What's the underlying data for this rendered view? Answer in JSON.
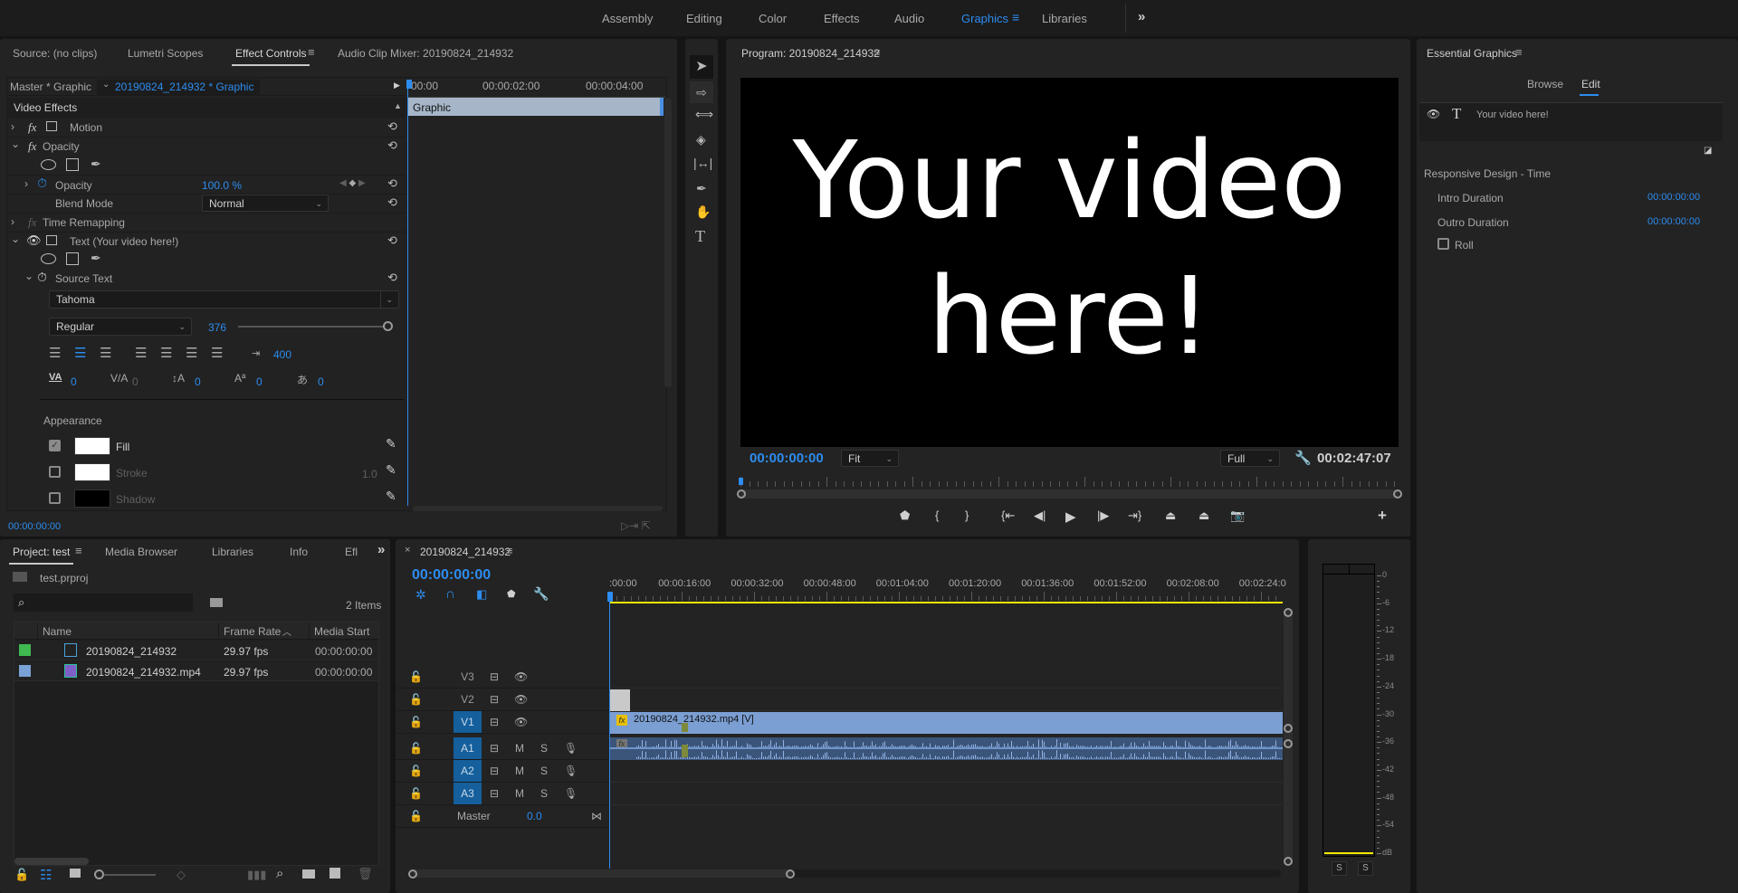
{
  "workspaces": {
    "items": [
      "Assembly",
      "Editing",
      "Color",
      "Effects",
      "Audio",
      "Graphics",
      "Libraries"
    ],
    "active": "Graphics",
    "more_icon": "chevron-double-right-icon"
  },
  "effect_controls": {
    "tabs": [
      "Source: (no clips)",
      "Lumetri Scopes",
      "Effect Controls",
      "Audio Clip Mixer: 20190824_214932"
    ],
    "active_tab": "Effect Controls",
    "master_label": "Master * Graphic",
    "clip_label": "20190824_214932 * Graphic",
    "section": "Video Effects",
    "motion": "Motion",
    "opacity": "Opacity",
    "opacity_prop": "Opacity",
    "opacity_value": "100.0 %",
    "blend_mode_label": "Blend Mode",
    "blend_mode": "Normal",
    "time_remapping": "Time Remapping",
    "text_layer": "Text (Your video here!)",
    "source_text": "Source Text",
    "font": "Tahoma",
    "font_style": "Regular",
    "font_size": "376",
    "font_size_fraction": 1.0,
    "tab_width": "400",
    "kerning": "0",
    "tracking": "0",
    "leading": "0",
    "baseline": "0",
    "tsume": "0",
    "appearance": "Appearance",
    "fill": {
      "label": "Fill",
      "checked": true,
      "color": "#ffffff"
    },
    "stroke": {
      "label": "Stroke",
      "checked": false,
      "color": "#ffffff",
      "width": "1.0"
    },
    "shadow": {
      "label": "Shadow",
      "checked": false,
      "color": "#000000"
    },
    "timecode": "00:00:00:00",
    "mini_timeline": {
      "ticks": [
        "00:00",
        "00:00:02:00",
        "00:00:04:00"
      ],
      "clip": "Graphic"
    }
  },
  "tools": [
    "selection-tool",
    "track-select-tool",
    "ripple-edit-tool",
    "razor-tool",
    "slip-tool",
    "pen-tool",
    "hand-tool",
    "type-tool"
  ],
  "program": {
    "title": "Program: 20190824_214932",
    "video_text_line1": "Your video",
    "video_text_line2": "here!",
    "timecode": "00:00:00:00",
    "zoom": "Fit",
    "resolution": "Full",
    "duration": "00:02:47:07"
  },
  "essential_graphics": {
    "title": "Essential Graphics",
    "tabs": [
      "Browse",
      "Edit"
    ],
    "active_tab": "Edit",
    "layer": "Your video here!",
    "section": "Responsive Design - Time",
    "intro_label": "Intro Duration",
    "intro_value": "00:00:00:00",
    "outro_label": "Outro Duration",
    "outro_value": "00:00:00:00",
    "roll_label": "Roll",
    "roll_checked": false
  },
  "project": {
    "tabs": [
      "Project: test",
      "Media Browser",
      "Libraries",
      "Info",
      "Efl"
    ],
    "active_tab": "Project: test",
    "file": "test.prproj",
    "search_placeholder": "",
    "item_count": "2 Items",
    "columns": [
      "Name",
      "Frame Rate",
      "Media Start"
    ],
    "rows": [
      {
        "label_color": "#3fb950",
        "name": "20190824_214932",
        "frame_rate": "29.97 fps",
        "media_start": "00:00:00:00",
        "icon": "sequence-icon"
      },
      {
        "label_color": "#7ba2d6",
        "name": "20190824_214932.mp4",
        "frame_rate": "29.97 fps",
        "media_start": "00:00:00:00",
        "icon": "video-clip-icon"
      }
    ]
  },
  "timeline": {
    "sequence": "20190824_214932",
    "timecode": "00:00:00:00",
    "ruler": [
      ":00:00",
      "00:00:16:00",
      "00:00:32:00",
      "00:00:48:00",
      "00:01:04:00",
      "00:01:20:00",
      "00:01:36:00",
      "00:01:52:00",
      "00:02:08:00",
      "00:02:24:0"
    ],
    "video_tracks": [
      "V3",
      "V2",
      "V1"
    ],
    "audio_tracks": [
      "A1",
      "A2",
      "A3"
    ],
    "mute": "M",
    "solo": "S",
    "master_label": "Master",
    "master_value": "0.0",
    "video_clip": "20190824_214932.mp4 [V]",
    "clip_color": "#7b9fd3",
    "audio_clip_color": "#3b5479"
  },
  "audio_meter": {
    "scale": [
      "0",
      "-6",
      "-12",
      "-18",
      "-24",
      "-30",
      "-36",
      "-42",
      "-48",
      "-54",
      "dB"
    ],
    "solo_buttons": [
      "S",
      "S"
    ]
  },
  "colors": {
    "accent": "#2d8cef",
    "panel": "#232323",
    "playhead": "#2d8cef",
    "work_area": "#f4ea00"
  }
}
